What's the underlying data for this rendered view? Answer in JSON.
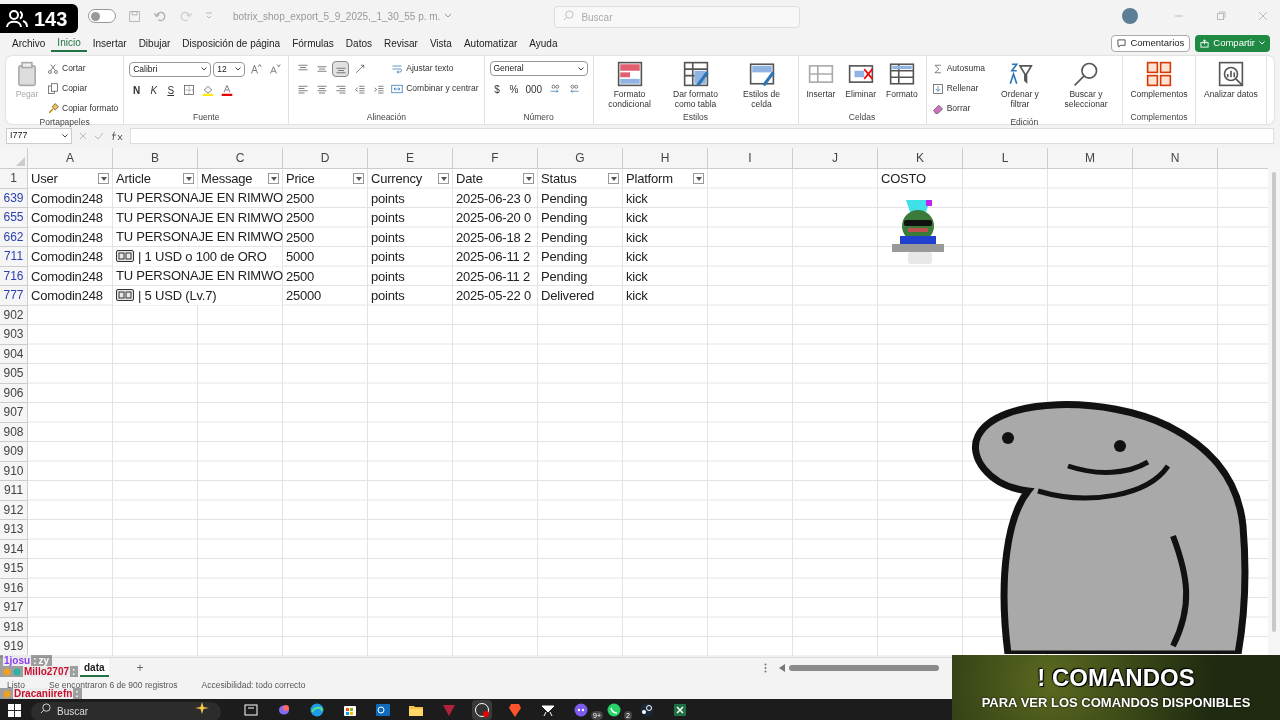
{
  "viewer_badge": {
    "count": "143"
  },
  "title_bar": {
    "autosave": false,
    "document_title": "botrix_shop_export_5_9_2025,_1_30_55 p. m.",
    "search_placeholder": "Buscar"
  },
  "menu_tabs": [
    {
      "label": "Archivo",
      "selected": false
    },
    {
      "label": "Inicio",
      "selected": true
    },
    {
      "label": "Insertar",
      "selected": false
    },
    {
      "label": "Dibujar",
      "selected": false
    },
    {
      "label": "Disposición de página",
      "selected": false
    },
    {
      "label": "Fórmulas",
      "selected": false
    },
    {
      "label": "Datos",
      "selected": false
    },
    {
      "label": "Revisar",
      "selected": false
    },
    {
      "label": "Vista",
      "selected": false
    },
    {
      "label": "Automatizar",
      "selected": false
    },
    {
      "label": "Ayuda",
      "selected": false
    }
  ],
  "header_buttons": {
    "comments": "Comentarios",
    "share": "Compartir"
  },
  "ribbon": [
    {
      "label": "Portapapeles",
      "items": [
        {
          "kind": "large",
          "label": "Pegar",
          "disabled": true
        },
        {
          "kind": "stack",
          "lines": [
            [
              {
                "kind": "small",
                "label": "Cortar"
              }
            ],
            [
              {
                "kind": "small",
                "label": "Copiar"
              }
            ],
            [
              {
                "kind": "small",
                "label": "Copiar formato"
              }
            ]
          ]
        }
      ]
    },
    {
      "label": "Fuente",
      "items": [
        {
          "kind": "stack",
          "lines": [
            [
              {
                "kind": "combo",
                "value": "Calibri"
              },
              {
                "kind": "combo",
                "value": "12"
              },
              {
                "kind": "icon"
              },
              {
                "kind": "icon"
              }
            ],
            [
              {
                "kind": "bold",
                "label": "N"
              },
              {
                "kind": "italic",
                "label": "K"
              },
              {
                "kind": "underline",
                "label": "S"
              },
              {
                "kind": "icon"
              },
              {
                "kind": "icon"
              },
              {
                "kind": "icon"
              }
            ]
          ]
        }
      ]
    },
    {
      "label": "Alineación",
      "items": [
        {
          "kind": "stack",
          "lines": [
            [
              {
                "kind": "icon",
                "selected": false
              },
              {
                "kind": "icon",
                "selected": false
              },
              {
                "kind": "icon",
                "selected": true
              },
              {
                "kind": "icon"
              }
            ],
            [
              {
                "kind": "icon"
              },
              {
                "kind": "icon"
              },
              {
                "kind": "icon"
              },
              {
                "kind": "icon"
              },
              {
                "kind": "icon"
              }
            ]
          ]
        },
        {
          "kind": "stack",
          "lines": [
            [
              {
                "kind": "small",
                "label": "Ajustar texto"
              }
            ],
            [
              {
                "kind": "small",
                "label": "Combinar y centrar"
              }
            ]
          ]
        }
      ]
    },
    {
      "label": "Número",
      "items": [
        {
          "kind": "stack",
          "lines": [
            [
              {
                "kind": "combo",
                "value": "General"
              }
            ],
            [
              {
                "kind": "glyph",
                "label": "$"
              },
              {
                "kind": "glyph",
                "label": "%"
              },
              {
                "kind": "glyph",
                "label": "000"
              },
              {
                "kind": "icon"
              },
              {
                "kind": "icon"
              }
            ]
          ]
        }
      ]
    },
    {
      "label": "Estilos",
      "items": [
        {
          "kind": "large",
          "label": "Formato condicional",
          "disabled": false
        },
        {
          "kind": "large",
          "label": "Dar formato como tabla",
          "disabled": false
        },
        {
          "kind": "large",
          "label": "Estilos de celda",
          "disabled": false
        }
      ]
    },
    {
      "label": "Celdas",
      "items": [
        {
          "kind": "large",
          "label": "Insertar",
          "disabled": false
        },
        {
          "kind": "large",
          "label": "Eliminar",
          "disabled": false
        },
        {
          "kind": "large",
          "label": "Formato",
          "disabled": false
        }
      ]
    },
    {
      "label": "Edición",
      "items": [
        {
          "kind": "stack",
          "lines": [
            [
              {
                "kind": "small",
                "label": "Autosuma"
              }
            ],
            [
              {
                "kind": "small",
                "label": "Rellenar"
              }
            ],
            [
              {
                "kind": "small",
                "label": "Borrar"
              }
            ]
          ]
        },
        {
          "kind": "large",
          "label": "Ordenar y filtrar",
          "disabled": false
        },
        {
          "kind": "large",
          "label": "Buscar y seleccionar",
          "disabled": false
        }
      ]
    },
    {
      "label": "Complementos",
      "items": [
        {
          "kind": "large",
          "label": "Complementos",
          "disabled": false
        }
      ]
    },
    {
      "items": [
        {
          "kind": "large",
          "label": "Analizar datos",
          "disabled": false
        }
      ]
    }
  ],
  "formula_bar": {
    "name_box": "I777"
  },
  "sheet": {
    "columns": [
      "A",
      "B",
      "C",
      "D",
      "E",
      "F",
      "G",
      "H",
      "I",
      "J",
      "K",
      "L",
      "M",
      "N"
    ],
    "header_row": {
      "number": "1",
      "labels": [
        "User",
        "Article",
        "Message",
        "Price",
        "Currency",
        "Date",
        "Status",
        "Platform"
      ],
      "extra_label": "COSTO"
    },
    "rows": [
      {
        "number": "639",
        "user": "Comodin248",
        "article": "TU PERSONAJE EN RIMWO",
        "article_icon": false,
        "price": "2500",
        "currency": "points",
        "date": "2025-06-23 0",
        "status": "Pending",
        "platform": "kick"
      },
      {
        "number": "655",
        "user": "Comodin248",
        "article": "TU PERSONAJE EN RIMWO",
        "article_icon": false,
        "price": "2500",
        "currency": "points",
        "date": "2025-06-20 0",
        "status": "Pending",
        "platform": "kick"
      },
      {
        "number": "662",
        "user": "Comodin248",
        "article": "TU PERSONAJE EN RIMWO",
        "article_icon": false,
        "price": "2500",
        "currency": "points",
        "date": "2025-06-18 2",
        "status": "Pending",
        "platform": "kick"
      },
      {
        "number": "711",
        "user": "Comodin248",
        "article": "| 1 USD o 100 de ORO",
        "article_icon": true,
        "price": "5000",
        "currency": "points",
        "date": "2025-06-11 2",
        "status": "Pending",
        "platform": "kick"
      },
      {
        "number": "716",
        "user": "Comodin248",
        "article": "TU PERSONAJE EN RIMWO",
        "article_icon": false,
        "price": "2500",
        "currency": "points",
        "date": "2025-06-11 2",
        "status": "Pending",
        "platform": "kick"
      },
      {
        "number": "777",
        "user": "Comodin248",
        "article": "| 5 USD (Lv.7)",
        "article_icon": true,
        "price": "25000",
        "currency": "points",
        "date": "2025-05-22 0",
        "status": "Delivered",
        "platform": "kick"
      }
    ],
    "empty_rows": [
      "902",
      "903",
      "904",
      "905",
      "906",
      "907",
      "908",
      "909",
      "910",
      "911",
      "912",
      "913",
      "914",
      "915",
      "916",
      "917",
      "918",
      "919"
    ]
  },
  "sheet_tabs": [
    {
      "label": "data",
      "selected": true
    }
  ],
  "add_sheet": "+",
  "status_bar": [
    "Listo",
    "Se encontraron 6 de 900 registros",
    "Accesibilidad: todo correcto"
  ],
  "chat": [
    {
      "user": "1josu",
      "separator": ":",
      "text": "zy",
      "color": "#8a3cf0"
    },
    {
      "user": "Millo2707",
      "separator": ":",
      "color": "#c8102e"
    },
    {
      "user": "Dracaniirefn",
      "separator": ":",
      "color": "#c8102e"
    }
  ],
  "banner": {
    "title": "! COMANDOS",
    "subtitle": "PARA VER LOS COMANDOS DISPONIBLES"
  },
  "taskbar": {
    "search_placeholder": "Buscar",
    "apps": [
      {
        "active": false
      },
      {
        "active": false
      },
      {
        "active": false
      },
      {
        "active": false
      },
      {
        "active": false
      },
      {
        "active": false
      },
      {
        "active": false
      },
      {
        "active": true
      },
      {
        "active": false
      },
      {
        "active": false
      },
      {
        "active": false,
        "badge": "9+"
      },
      {
        "active": false,
        "badge": "2"
      },
      {
        "active": false
      },
      {
        "active": false
      }
    ]
  }
}
